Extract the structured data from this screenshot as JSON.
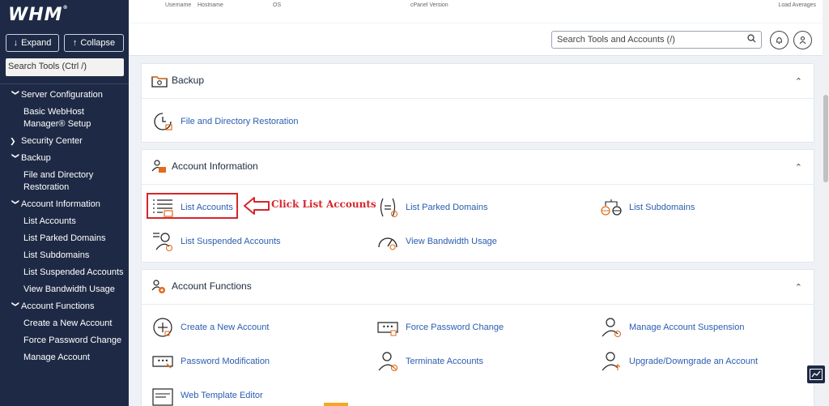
{
  "sidebar": {
    "logo": "WHM",
    "expand_label": "Expand",
    "collapse_label": "Collapse",
    "search_placeholder": "Search Tools (Ctrl /)",
    "items": [
      {
        "label": "Server Configuration",
        "type": "section",
        "icon": "chevron-down-icon"
      },
      {
        "label": "Basic WebHost Manager® Setup",
        "type": "sub"
      },
      {
        "label": "Security Center",
        "type": "section",
        "icon": "chevron-right-icon"
      },
      {
        "label": "Backup",
        "type": "section",
        "icon": "chevron-down-icon"
      },
      {
        "label": "File and Directory Restoration",
        "type": "sub"
      },
      {
        "label": "Account Information",
        "type": "section",
        "icon": "chevron-down-icon"
      },
      {
        "label": "List Accounts",
        "type": "sub"
      },
      {
        "label": "List Parked Domains",
        "type": "sub"
      },
      {
        "label": "List Subdomains",
        "type": "sub"
      },
      {
        "label": "List Suspended Accounts",
        "type": "sub"
      },
      {
        "label": "View Bandwidth Usage",
        "type": "sub"
      },
      {
        "label": "Account Functions",
        "type": "section",
        "icon": "chevron-down-icon"
      },
      {
        "label": "Create a New Account",
        "type": "sub"
      },
      {
        "label": "Force Password Change",
        "type": "sub"
      },
      {
        "label": "Manage Account",
        "type": "sub"
      }
    ]
  },
  "topbar": {
    "stats": [
      "Username",
      "Hostname",
      "OS",
      "cPanel Version",
      "Load Averages"
    ],
    "search_placeholder": "Search Tools and Accounts (/)"
  },
  "cards": {
    "backup": {
      "title": "Backup",
      "tools": [
        "File and Directory Restoration"
      ]
    },
    "account_info": {
      "title": "Account Information",
      "tools": [
        "List Accounts",
        "List Parked Domains",
        "List Subdomains",
        "List Suspended Accounts",
        "View Bandwidth Usage"
      ]
    },
    "account_functions": {
      "title": "Account Functions",
      "tools": [
        "Create a New Account",
        "Force Password Change",
        "Manage Account Suspension",
        "Password Modification",
        "Terminate Accounts",
        "Upgrade/Downgrade an Account",
        "Web Template Editor"
      ]
    }
  },
  "callout": {
    "text": "Click List Accounts"
  },
  "colors": {
    "sidebar_bg": "#1e2a45",
    "link": "#2a5db0",
    "accent_red": "#d6262b",
    "icon_orange": "#e06c1c"
  }
}
